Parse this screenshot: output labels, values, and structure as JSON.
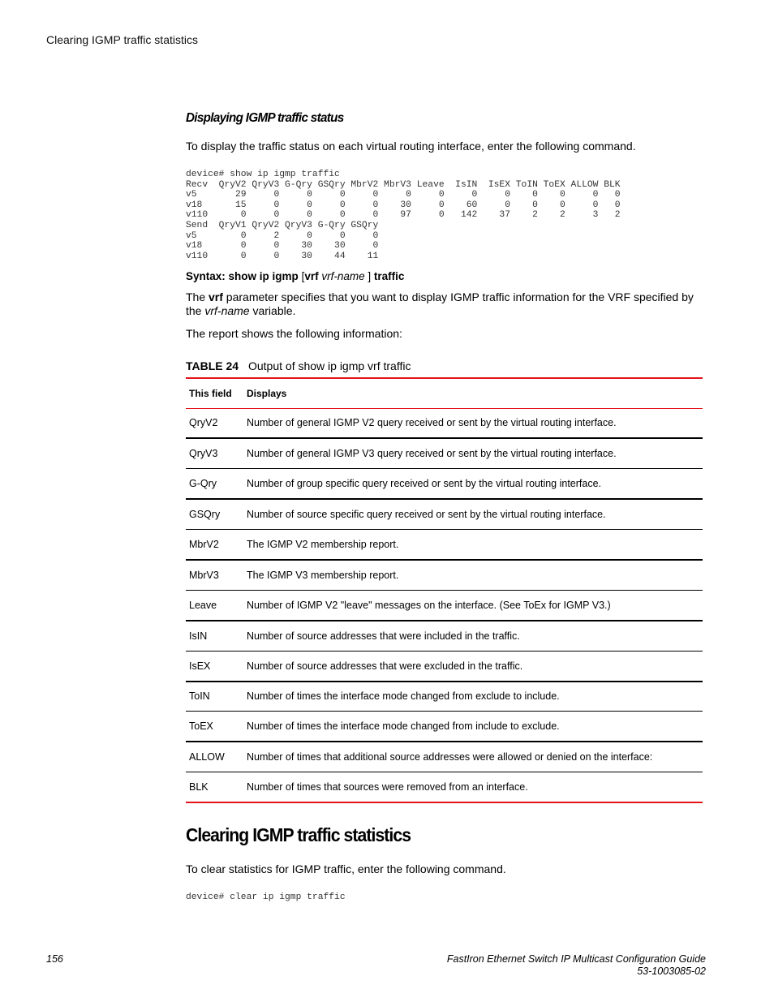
{
  "running_header": "Clearing IGMP traffic statistics",
  "section1": {
    "heading": "Displaying IGMP traffic status",
    "intro": "To display the traffic status on each virtual routing interface, enter the following command.",
    "code": "device# show ip igmp traffic\nRecv  QryV2 QryV3 G-Qry GSQry MbrV2 MbrV3 Leave  IsIN  IsEX ToIN ToEX ALLOW BLK\nv5       29     0     0     0     0     0     0     0     0    0    0     0   0\nv18      15     0     0     0     0    30     0    60     0    0    0     0   0\nv110      0     0     0     0     0    97     0   142    37    2    2     3   2\nSend  QryV1 QryV2 QryV3 G-Qry GSQry\nv5        0     2     0     0     0\nv18       0     0    30    30     0\nv110      0     0    30    44    11",
    "syntax": {
      "label": "Syntax:",
      "cmd1": "show ip igmp",
      "bracket_open": "[",
      "vrf": "vrf",
      "var": "vrf-name",
      "bracket_close": "]",
      "cmd2": "traffic"
    },
    "desc": {
      "p1_pre": "The ",
      "p1_bold": "vrf",
      "p1_mid": " parameter specifies that you want to display IGMP traffic information for the VRF specified by the ",
      "p1_ital": "vrf-name",
      "p1_post": " variable."
    },
    "report_intro": "The report shows the following information:"
  },
  "table": {
    "caption_label": "TABLE 24",
    "caption_text": "Output of show ip igmp vrf traffic",
    "headers": [
      "This field",
      "Displays"
    ],
    "rows": [
      {
        "field": "QryV2",
        "desc": "Number of general IGMP V2 query received or sent by the virtual routing interface."
      },
      {
        "field": "QryV3",
        "desc": "Number of general IGMP V3 query received or sent by the virtual routing interface."
      },
      {
        "field": "G-Qry",
        "desc": "Number of group specific query received or sent by the virtual routing interface."
      },
      {
        "field": "GSQry",
        "desc": "Number of source specific query received or sent by the virtual routing interface."
      },
      {
        "field": "MbrV2",
        "desc": "The IGMP V2 membership report."
      },
      {
        "field": "MbrV3",
        "desc": "The IGMP V3 membership report."
      },
      {
        "field": "Leave",
        "desc": "Number of IGMP V2 \"leave\" messages on the interface. (See ToEx for IGMP V3.)"
      },
      {
        "field": "IsIN",
        "desc": "Number of source addresses that were included in the traffic."
      },
      {
        "field": "IsEX",
        "desc": "Number of source addresses that were excluded in the traffic."
      },
      {
        "field": "ToIN",
        "desc": "Number of times the interface mode changed from exclude to include."
      },
      {
        "field": "ToEX",
        "desc": "Number of times the interface mode changed from include to exclude."
      },
      {
        "field": "ALLOW",
        "desc": "Number of times that additional source addresses were allowed or denied on the interface:"
      },
      {
        "field": "BLK",
        "desc": "Number of times that sources were removed from an interface."
      }
    ]
  },
  "section2": {
    "heading": "Clearing IGMP traffic statistics",
    "intro": "To clear statistics for IGMP traffic, enter the following command.",
    "code": "device# clear ip igmp traffic"
  },
  "footer": {
    "page_number": "156",
    "doc_title": "FastIron Ethernet Switch IP Multicast Configuration Guide",
    "doc_number": "53-1003085-02"
  },
  "colors": {
    "accent_red": "#e4141b"
  }
}
